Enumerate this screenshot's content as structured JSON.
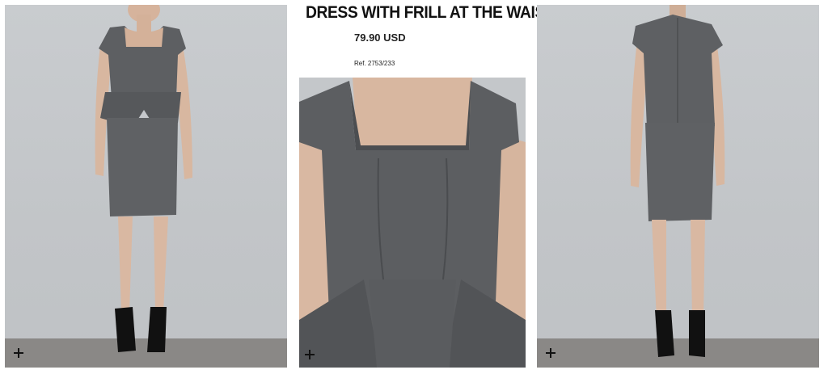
{
  "product": {
    "title": "DRESS WITH FRILL AT THE WAIST",
    "price": "79.90 USD",
    "ref": "Ref. 2753/233"
  },
  "gallery": {
    "images": [
      {
        "view": "front full-length",
        "zoom_icon": "plus-icon"
      },
      {
        "view": "front detail close-up",
        "zoom_icon": "plus-icon"
      },
      {
        "view": "back full-length",
        "zoom_icon": "plus-icon"
      }
    ]
  },
  "colors": {
    "dress": "#5f6062",
    "background": "#c6c9cc",
    "skin": "#d9b8a2",
    "floor": "#8a8886"
  }
}
